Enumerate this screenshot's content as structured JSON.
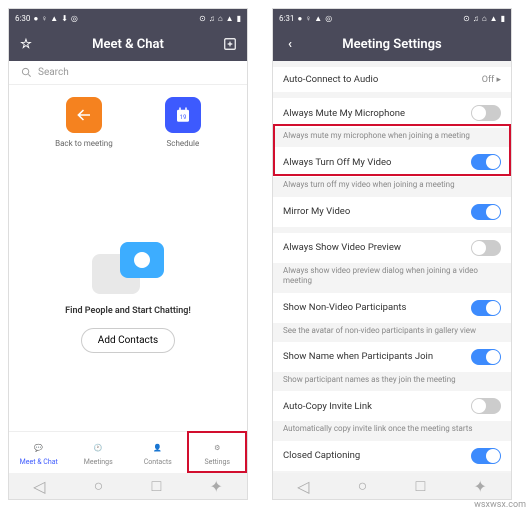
{
  "left": {
    "status_time": "6:30",
    "header_title": "Meet & Chat",
    "search_placeholder": "Search",
    "actions": [
      {
        "label": "Back to meeting"
      },
      {
        "label": "Schedule"
      }
    ],
    "empty_title": "Find People and Start Chatting!",
    "empty_button": "Add Contacts",
    "tabs": [
      {
        "label": "Meet & Chat"
      },
      {
        "label": "Meetings"
      },
      {
        "label": "Contacts"
      },
      {
        "label": "Settings"
      }
    ]
  },
  "right": {
    "status_time": "6:31",
    "header_title": "Meeting Settings",
    "rows": {
      "auto_connect": {
        "title": "Auto-Connect to Audio",
        "value": "Off ▸"
      },
      "mute_mic": {
        "title": "Always Mute My Microphone",
        "sub": "Always mute my microphone when joining a meeting"
      },
      "turn_off_video": {
        "title": "Always Turn Off My Video",
        "sub": "Always turn off my video when joining a meeting"
      },
      "mirror": {
        "title": "Mirror My Video"
      },
      "show_preview": {
        "title": "Always Show Video Preview",
        "sub": "Always show video preview dialog when joining a video meeting"
      },
      "non_video": {
        "title": "Show Non-Video Participants",
        "sub": "See the avatar of non-video participants in gallery view"
      },
      "show_name": {
        "title": "Show Name when Participants Join",
        "sub": "Show participant names as they join the meeting"
      },
      "auto_copy": {
        "title": "Auto-Copy Invite Link",
        "sub": "Automatically copy invite link once the meeting starts"
      },
      "cc": {
        "title": "Closed Captioning"
      }
    }
  },
  "watermark": "wsxwsx.com"
}
